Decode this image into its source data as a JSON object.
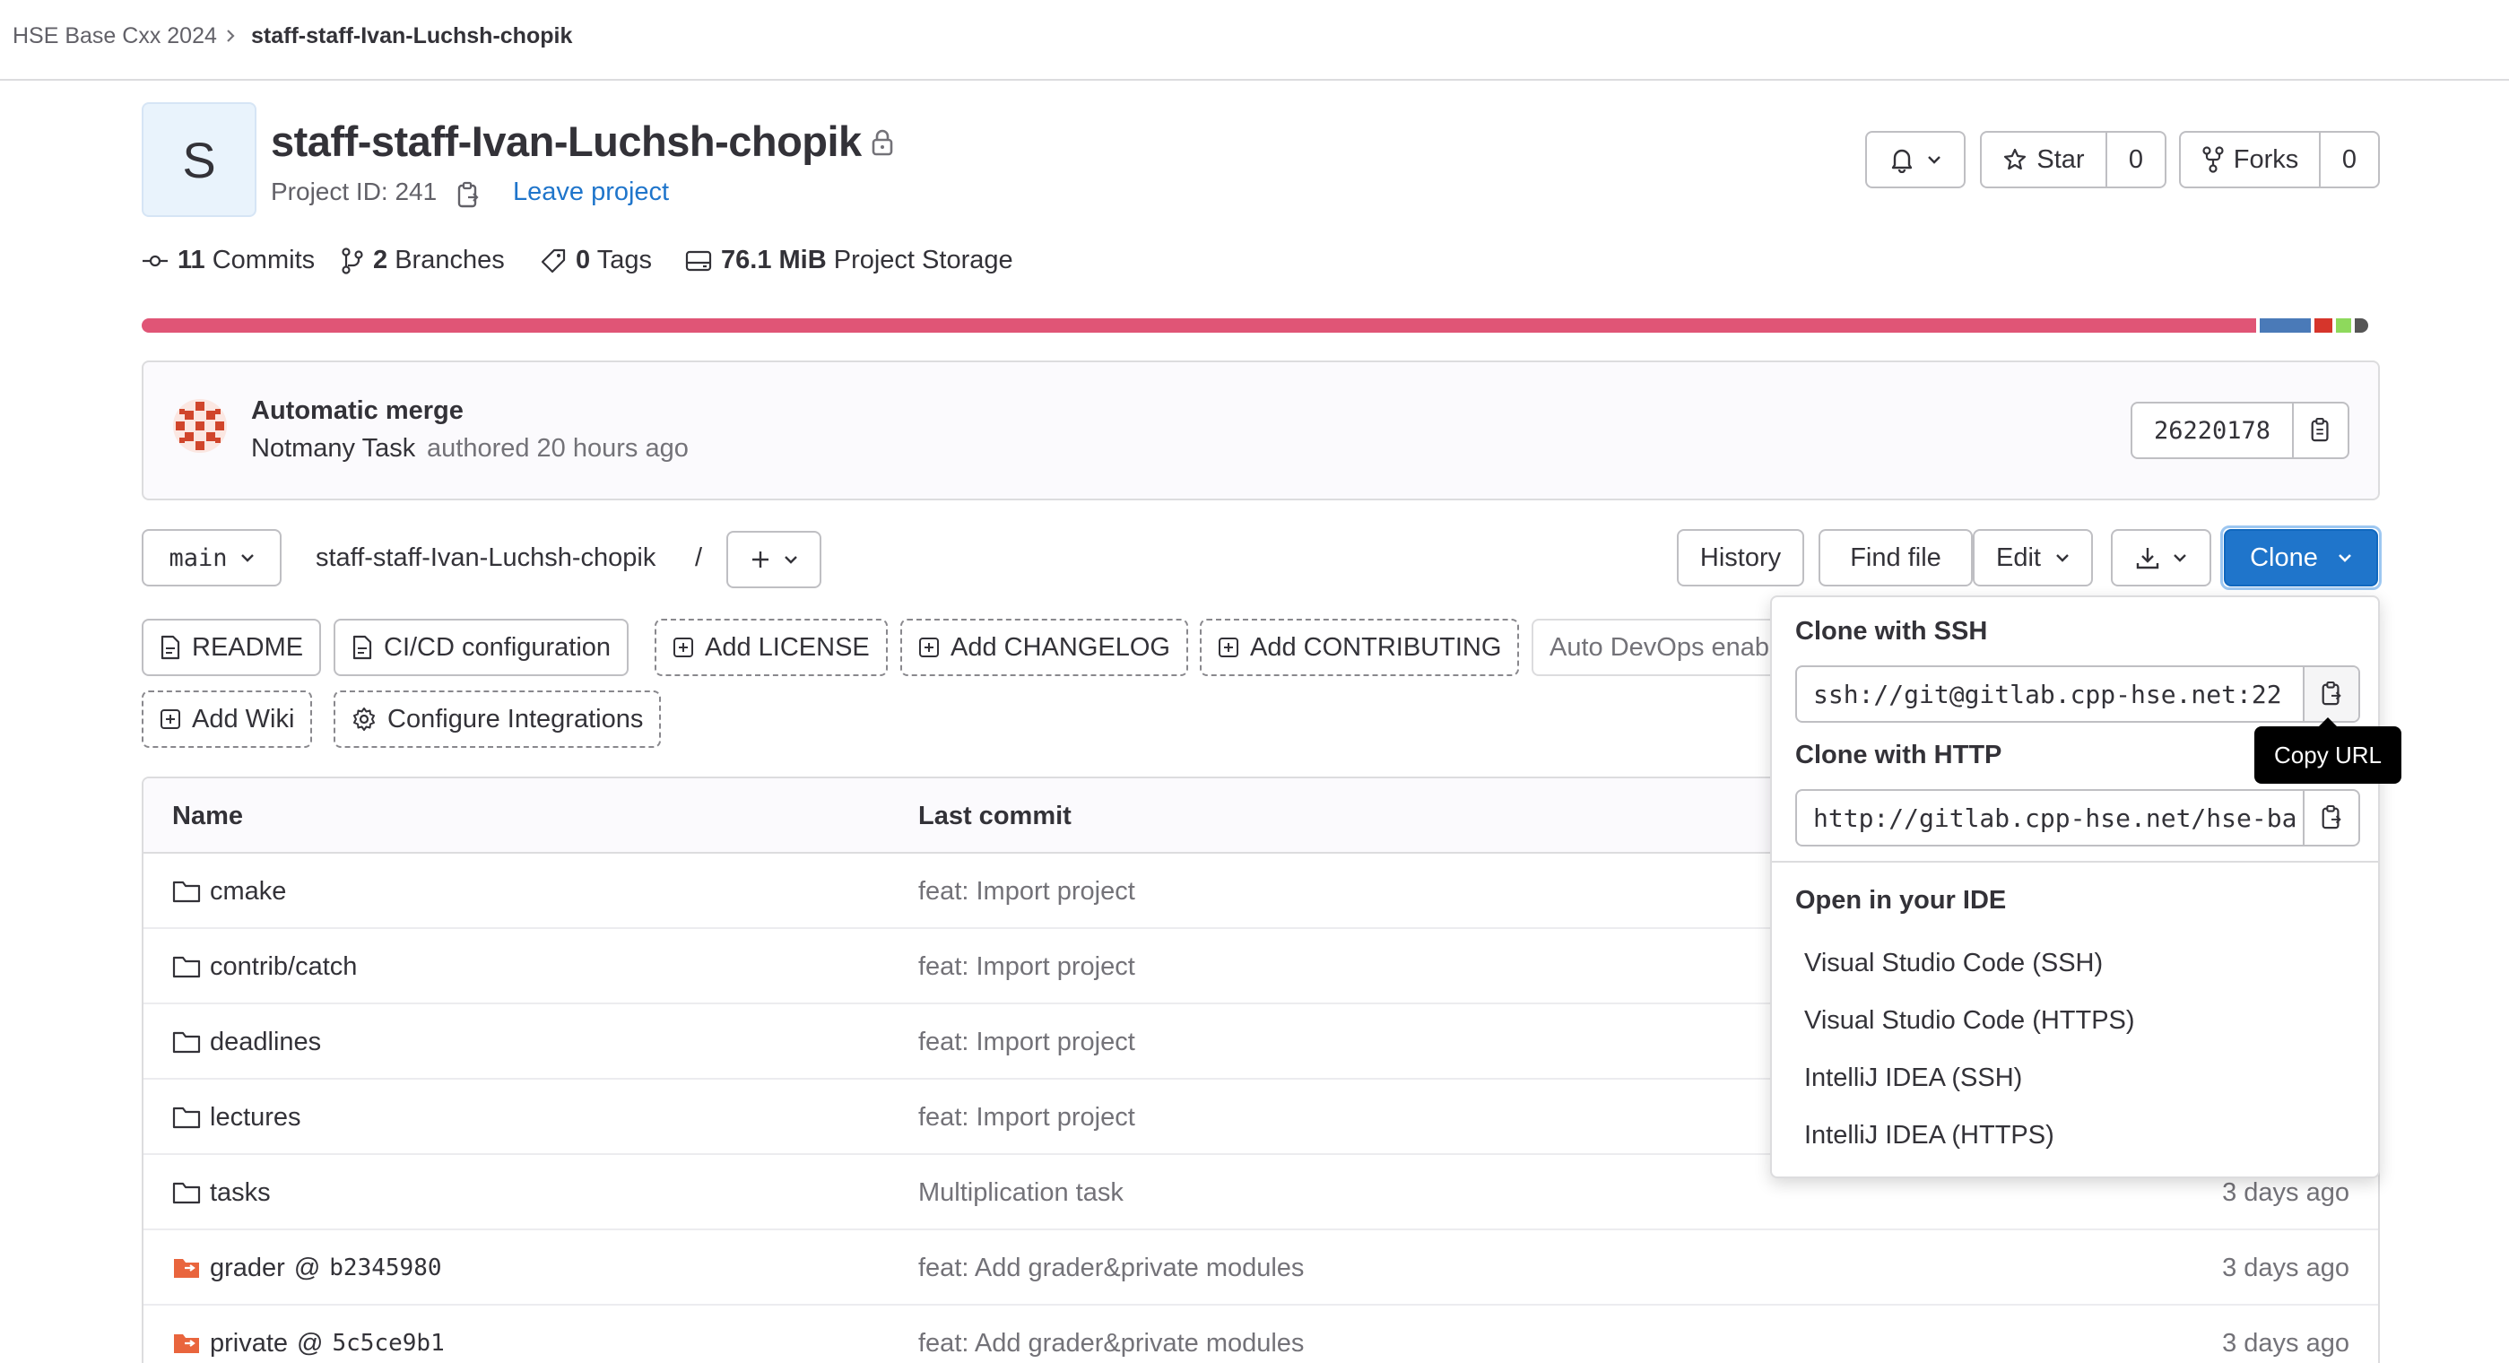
{
  "breadcrumb": {
    "group": "HSE Base Cxx 2024",
    "project": "staff-staff-Ivan-Luchsh-chopik"
  },
  "project": {
    "avatar_letter": "S",
    "title": "staff-staff-Ivan-Luchsh-chopik",
    "project_id": "Project ID: 241",
    "leave_label": "Leave project"
  },
  "header_actions": {
    "star_label": "Star",
    "star_count": "0",
    "forks_label": "Forks",
    "forks_count": "0"
  },
  "stats": {
    "commits_count": "11",
    "commits_label": "Commits",
    "branches_count": "2",
    "branches_label": "Branches",
    "tags_count": "0",
    "tags_label": "Tags",
    "storage_size": "76.1 MiB",
    "storage_label": "Project Storage"
  },
  "language_bar": [
    {
      "fraction": 0.951,
      "color": "#e05576"
    },
    {
      "fraction": 0.023,
      "color": "#4a7ab8"
    },
    {
      "fraction": 0.008,
      "color": "#d6352b"
    },
    {
      "fraction": 0.007,
      "color": "#8ed95c"
    },
    {
      "fraction": 0.006,
      "color": "#555555"
    }
  ],
  "last_commit": {
    "message": "Automatic merge",
    "author": "Notmany Task",
    "authored_text": "authored 20 hours ago",
    "sha": "26220178"
  },
  "toolbar": {
    "branch": "main",
    "path": "staff-staff-Ivan-Luchsh-chopik",
    "path_sep": "/",
    "history": "History",
    "find_file": "Find file",
    "edit": "Edit",
    "clone": "Clone"
  },
  "shortcuts": {
    "readme": "README",
    "cicd": "CI/CD configuration",
    "add_license": "Add LICENSE",
    "add_changelog": "Add CHANGELOG",
    "add_contributing": "Add CONTRIBUTING",
    "auto_devops": "Auto DevOps enab",
    "add_wiki": "Add Wiki",
    "configure_integrations": "Configure Integrations"
  },
  "table": {
    "headers": {
      "name": "Name",
      "last_commit": "Last commit"
    },
    "rows": [
      {
        "name": "cmake",
        "commit": "feat: Import project",
        "date": ""
      },
      {
        "name": "contrib/catch",
        "commit": "feat: Import project",
        "date": ""
      },
      {
        "name": "deadlines",
        "commit": "feat: Import project",
        "date": ""
      },
      {
        "name": "lectures",
        "commit": "feat: Import project",
        "date": ""
      },
      {
        "name": "tasks",
        "commit": "Multiplication task",
        "date": "3 days ago"
      },
      {
        "name": "grader",
        "sub_sha": "b2345980",
        "commit": "feat: Add grader&private modules",
        "date": "3 days ago"
      },
      {
        "name": "private",
        "sub_sha": "5c5ce9b1",
        "commit": "feat: Add grader&private modules",
        "date": "3 days ago"
      }
    ],
    "at_sign": "@"
  },
  "clone_dropdown": {
    "ssh_heading": "Clone with SSH",
    "ssh_url": "ssh://git@gitlab.cpp-hse.net:22",
    "http_heading": "Clone with HTTP",
    "http_url": "http://gitlab.cpp-hse.net/hse-ba",
    "ide_heading": "Open in your IDE",
    "ide_options": [
      "Visual Studio Code (SSH)",
      "Visual Studio Code (HTTPS)",
      "IntelliJ IDEA (SSH)",
      "IntelliJ IDEA (HTTPS)"
    ],
    "tooltip": "Copy URL"
  },
  "colors": {
    "link": "#1f75cb",
    "primary": "#1f75cb",
    "submodule": "#e9653d"
  }
}
